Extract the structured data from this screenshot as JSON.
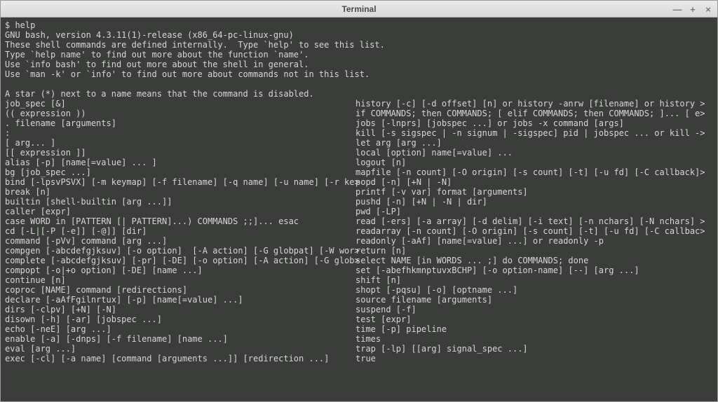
{
  "window": {
    "title": "Terminal",
    "controls": {
      "min": "—",
      "max": "+",
      "close": "×"
    }
  },
  "terminal": {
    "prompt": "$ ",
    "command": "help",
    "header_lines": [
      "GNU bash, version 4.3.11(1)-release (x86_64-pc-linux-gnu)",
      "These shell commands are defined internally.  Type `help' to see this list.",
      "Type `help name' to find out more about the function `name'.",
      "Use `info bash' to find out more about the shell in general.",
      "Use `man -k' or `info' to find out more about commands not in this list.",
      "",
      "A star (*) next to a name means that the command is disabled.",
      ""
    ],
    "left_col": [
      "job_spec [&]",
      "(( expression ))",
      ". filename [arguments]",
      ":",
      "[ arg... ]",
      "[[ expression ]]",
      "alias [-p] [name[=value] ... ]",
      "bg [job_spec ...]",
      "bind [-lpsvPSVX] [-m keymap] [-f filename] [-q name] [-u name] [-r ke>",
      "break [n]",
      "builtin [shell-builtin [arg ...]]",
      "caller [expr]",
      "case WORD in [PATTERN [| PATTERN]...) COMMANDS ;;]... esac",
      "cd [-L|[-P [-e]] [-@]] [dir]",
      "command [-pVv] command [arg ...]",
      "compgen [-abcdefgjksuv] [-o option]  [-A action] [-G globpat] [-W wor>",
      "complete [-abcdefgjksuv] [-pr] [-DE] [-o option] [-A action] [-G glob>",
      "compopt [-o|+o option] [-DE] [name ...]",
      "continue [n]",
      "coproc [NAME] command [redirections]",
      "declare [-aAfFgilnrtux] [-p] [name[=value] ...]",
      "dirs [-clpv] [+N] [-N]",
      "disown [-h] [-ar] [jobspec ...]",
      "echo [-neE] [arg ...]",
      "enable [-a] [-dnps] [-f filename] [name ...]",
      "eval [arg ...]",
      "exec [-cl] [-a name] [command [arguments ...]] [redirection ...]"
    ],
    "right_col": [
      "history [-c] [-d offset] [n] or history -anrw [filename] or history >",
      "if COMMANDS; then COMMANDS; [ elif COMMANDS; then COMMANDS; ]... [ e>",
      "jobs [-lnprs] [jobspec ...] or jobs -x command [args]",
      "kill [-s sigspec | -n signum | -sigspec] pid | jobspec ... or kill ->",
      "let arg [arg ...]",
      "local [option] name[=value] ...",
      "logout [n]",
      "mapfile [-n count] [-O origin] [-s count] [-t] [-u fd] [-C callback]>",
      "popd [-n] [+N | -N]",
      "printf [-v var] format [arguments]",
      "pushd [-n] [+N | -N | dir]",
      "pwd [-LP]",
      "read [-ers] [-a array] [-d delim] [-i text] [-n nchars] [-N nchars] >",
      "readarray [-n count] [-O origin] [-s count] [-t] [-u fd] [-C callbac>",
      "readonly [-aAf] [name[=value] ...] or readonly -p",
      "return [n]",
      "select NAME [in WORDS ... ;] do COMMANDS; done",
      "set [-abefhkmnptuvxBCHP] [-o option-name] [--] [arg ...]",
      "shift [n]",
      "shopt [-pqsu] [-o] [optname ...]",
      "source filename [arguments]",
      "suspend [-f]",
      "test [expr]",
      "time [-p] pipeline",
      "times",
      "trap [-lp] [[arg] signal_spec ...]",
      "true"
    ]
  }
}
